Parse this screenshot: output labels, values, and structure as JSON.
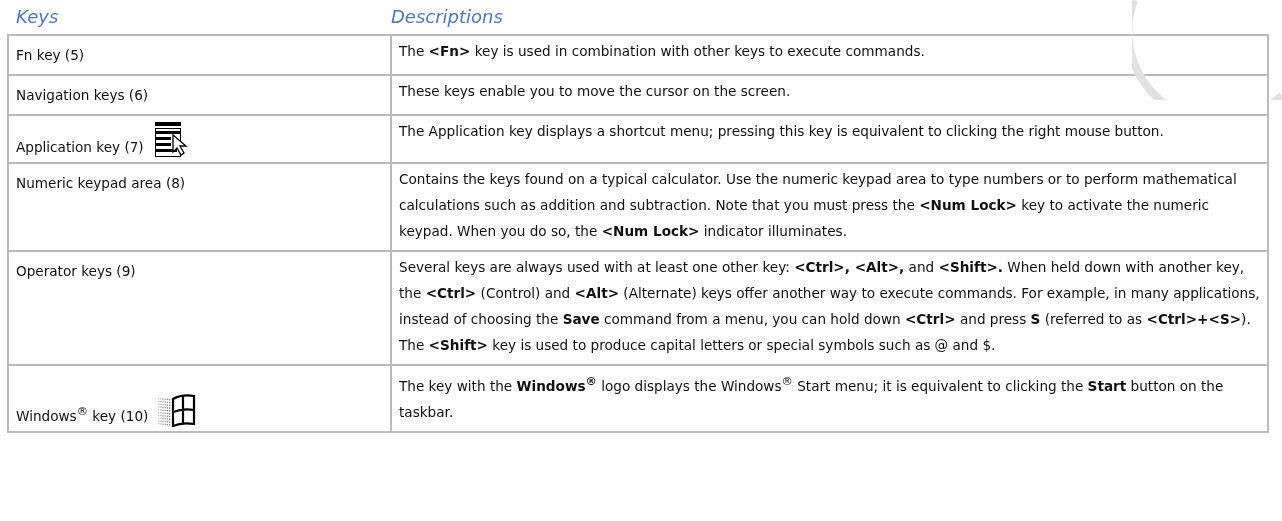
{
  "columns": [
    "Keys",
    "Descriptions"
  ],
  "rows": [
    {
      "kind": "plain",
      "key": "Fn key (5)",
      "description": "The **<Fn>** key is used in combination with other keys to execute commands."
    },
    {
      "kind": "plain",
      "key": "Navigation keys (6)",
      "description": "These keys enable you to move the cursor on the screen."
    },
    {
      "kind": "application",
      "key": "Application key (7)",
      "description": "The Application key displays a shortcut menu; pressing this key is equivalent to clicking the right mouse button."
    },
    {
      "kind": "plain",
      "key": "Numeric keypad area (8)",
      "description": "Contains the keys found on a typical calculator. Use the numeric keypad area to type numbers or to perform mathematical calculations such as addition and subtraction. Note that you must press the **<Num Lock>** key to activate the numeric keypad. When you do so, the **<Num Lock>** indicator illuminates."
    },
    {
      "kind": "plain",
      "key": "Operator keys (9)",
      "description": "Several keys are always used with at least one other key:  **<Ctrl>, <Alt>,** and **<Shift>.** When held down with another key, the **<Ctrl>** (Control) and **<Alt>** (Alternate) keys offer another way to execute commands. For example, in many applications, instead of choosing the **Save** command from a menu, you can hold down **<Ctrl>** and press **S** (referred to as **<Ctrl>+<S>**). The **<Shift>** key is used to produce capital letters or special symbols such as @ and $."
    },
    {
      "kind": "windows",
      "key": "Windows$^{®}$ key (10)",
      "description": "The key with the **Windows$^{®}$** logo displays the Windows$^{®}$ Start menu; it is equivalent to clicking the **Start** button on the taskbar."
    }
  ]
}
